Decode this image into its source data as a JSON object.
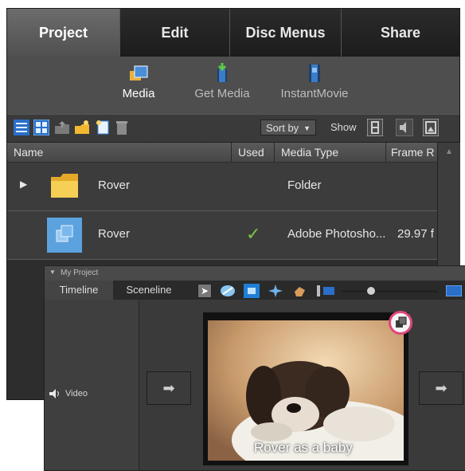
{
  "tabs": [
    "Project",
    "Edit",
    "Disc Menus",
    "Share"
  ],
  "media_buttons": {
    "media": "Media",
    "get_media": "Get Media",
    "instant_movie": "InstantMovie"
  },
  "toolbar": {
    "sort_by": "Sort by",
    "show": "Show"
  },
  "columns": [
    "Name",
    "Used",
    "Media Type",
    "Frame R"
  ],
  "rows": [
    {
      "name": "Rover",
      "used": "",
      "media_type": "Folder",
      "frame_rate": ""
    },
    {
      "name": "Rover",
      "used": "✓",
      "media_type": "Adobe Photosho...",
      "frame_rate": "29.97 f"
    }
  ],
  "project_panel": {
    "title": "My Project",
    "tabs": [
      "Timeline",
      "Sceneline"
    ],
    "track_label": "Video",
    "caption": "Rover as a baby"
  },
  "colors": {
    "active_tab": "#5a5a5a",
    "check": "#7cc444",
    "highlight_ring": "#e0467e"
  }
}
